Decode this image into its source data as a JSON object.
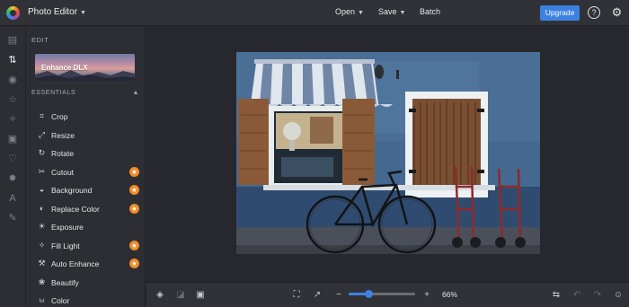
{
  "app": {
    "title": "Photo Editor"
  },
  "top_nav": {
    "open": "Open",
    "save": "Save",
    "batch": "Batch",
    "upgrade": "Upgrade",
    "help": "?"
  },
  "panel": {
    "title": "EDIT",
    "banner": "Enhance DLX",
    "section": "ESSENTIALS",
    "tools": [
      {
        "label": "Crop",
        "icon": "crop-icon",
        "premium": false
      },
      {
        "label": "Resize",
        "icon": "resize-icon",
        "premium": false
      },
      {
        "label": "Rotate",
        "icon": "rotate-icon",
        "premium": false
      },
      {
        "label": "Cutout",
        "icon": "scissors-icon",
        "premium": true
      },
      {
        "label": "Background",
        "icon": "background-icon",
        "premium": true
      },
      {
        "label": "Replace Color",
        "icon": "replace-color-icon",
        "premium": true
      },
      {
        "label": "Exposure",
        "icon": "exposure-icon",
        "premium": false
      },
      {
        "label": "Fill Light",
        "icon": "fill-light-icon",
        "premium": true
      },
      {
        "label": "Auto Enhance",
        "icon": "auto-enhance-icon",
        "premium": true
      },
      {
        "label": "Beautify",
        "icon": "beautify-icon",
        "premium": false
      },
      {
        "label": "Color",
        "icon": "color-icon",
        "premium": false
      }
    ]
  },
  "zoom": {
    "label": "66%",
    "value": 0.3
  },
  "colors": {
    "accent": "#3b82e0",
    "premium": "#f28c28",
    "background": "#27292f"
  }
}
